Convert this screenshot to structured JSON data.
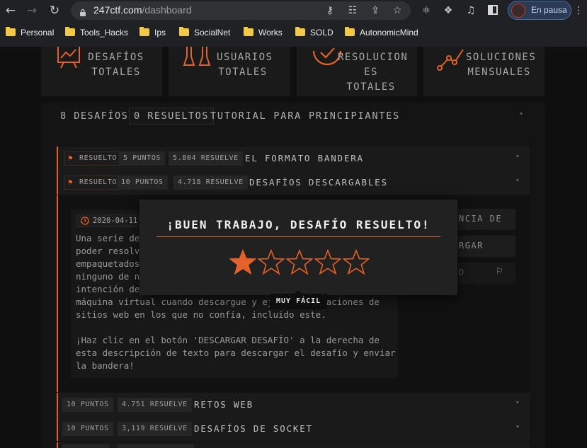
{
  "browser": {
    "url_host": "247ctf.com",
    "url_path": "/dashboard",
    "profile_label": "En pausa",
    "bookmarks": [
      "Personal",
      "Tools_Hacks",
      "Ips",
      "SocialNet",
      "Works",
      "SOLD",
      "AutonomicMind"
    ]
  },
  "stats": [
    {
      "line1": "DESAFÍOS",
      "line2": "TOTALES"
    },
    {
      "line1": "USUARIOS",
      "line2": "TOTALES"
    },
    {
      "line1": "RESOLUCION",
      "line2": "ES TOTALES"
    },
    {
      "line1": "SOLUCIONES",
      "line2": "MENSUALES"
    }
  ],
  "category": {
    "challenges": "8 DESAFÍOS",
    "solved": "0 RESUELTOS",
    "title": "TUTORIAL PARA PRINCIPIANTES"
  },
  "rows": [
    {
      "status": "RESUELTO",
      "points": "5 PUNTOS",
      "solves": "5.804 RESUELVE",
      "title": "EL FORMATO BANDERA"
    },
    {
      "status": "RESUELTO",
      "points": "10 PUNTOS",
      "solves": "4.718 RESUELVE",
      "title": "DESAFÍOS DESCARGABLES"
    },
    {
      "points": "10 PUNTOS",
      "solves": "4.751 RESUELVE",
      "title": "RETOS WEB"
    },
    {
      "points": "10 PUNTOS",
      "solves": "3,119 RESUELVE",
      "title": "DESAFÍOS DE SOCKET"
    }
  ],
  "detail": {
    "date": "2020-04-11",
    "description": "Una serie de\npoder resolv\nempaquetados\nninguno de n\nintención de\nmáquina virtual cuando descargue y ej          aciones de\nsitios web en los que no confía, incluido este.\n\n¡Haz clic en el botón 'DESCARGAR DESAFÍO' a la derecha de\nesta descripción de texto para descargar el desafío y enviar\nla bandera!",
    "side_buttons": [
      "NCIA DE",
      "RGAR",
      "D"
    ]
  },
  "modal": {
    "title": "¡BUEN TRABAJO, DESAFÍO RESUELTO!",
    "rating": 1,
    "max_rating": 5,
    "tooltip": "MUY FÁCIL"
  },
  "colors": {
    "accent": "#e4622a",
    "background": "#0f0f0f",
    "modal": "#212121"
  }
}
